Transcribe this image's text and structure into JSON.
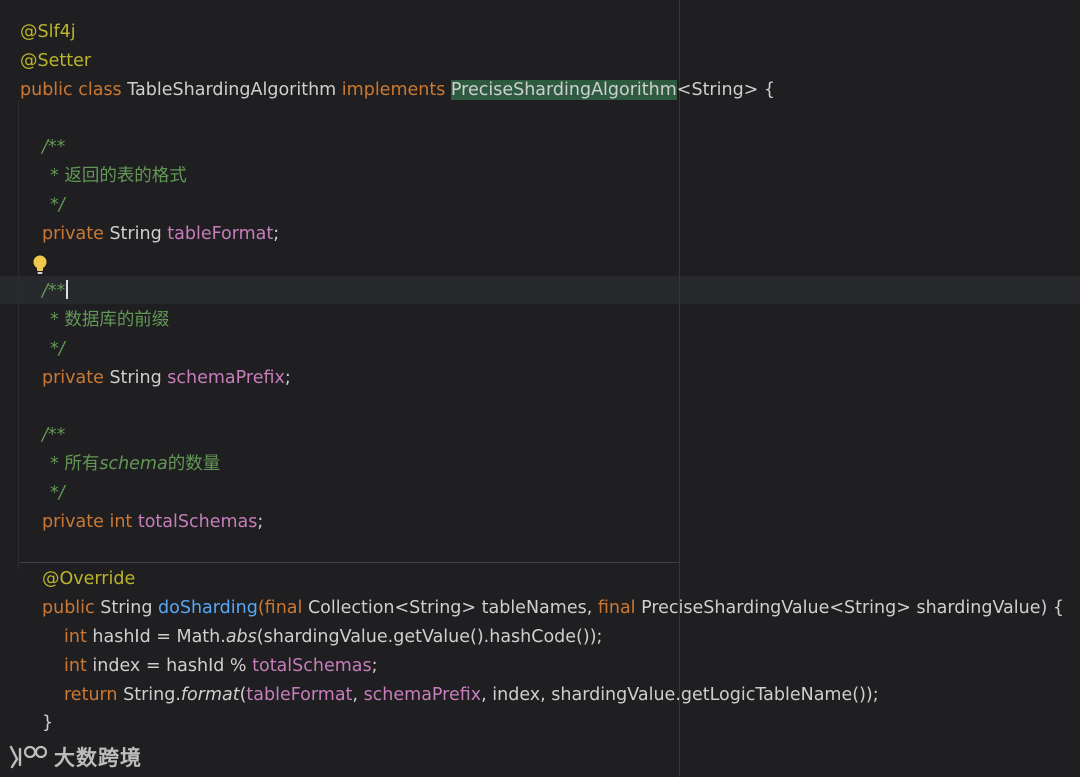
{
  "code": {
    "annotation_slf4j": "@Slf4j",
    "annotation_setter": "@Setter",
    "class_decl": {
      "public": "public",
      "class": "class",
      "name": "TableShardingAlgorithm",
      "implements": "implements",
      "interface": "PreciseShardingAlgorithm",
      "generic": "<String> {"
    },
    "comment_open": "/**",
    "comment_close": "*/",
    "doc_table_format": "* 返回的表的格式",
    "field_table_format": {
      "modifier": "private",
      "type": "String",
      "name": "tableFormat",
      "end": ";"
    },
    "doc_schema_prefix": "* 数据库的前缀",
    "field_schema_prefix": {
      "modifier": "private",
      "type": "String",
      "name": "schemaPrefix",
      "end": ";"
    },
    "doc_total_schemas": {
      "pre": "* 所有",
      "italic": "schema",
      "post": "的数量"
    },
    "field_total_schemas": {
      "modifier": "private",
      "type": "int",
      "name": "totalSchemas",
      "end": ";"
    },
    "override": "@Override",
    "method_decl": {
      "public": "public",
      "ret": "String",
      "name": "doSharding",
      "p_open": "(",
      "final1": "final",
      "param1": "Collection<String> tableNames, ",
      "final2": "final",
      "param2": "PreciseShardingValue<String> shardingValue) {"
    },
    "body1": {
      "type": "int",
      "a": "hashId = Math.",
      "b": "abs",
      "c": "(shardingValue.getValue().hashCode());"
    },
    "body2": {
      "type": "int",
      "a": "index = hashId % ",
      "field": "totalSchemas",
      "end": ";"
    },
    "body3": {
      "ret": "return",
      "a": "String.",
      "b": "format",
      "c": "(",
      "f1": "tableFormat",
      "comma": ", ",
      "f2": "schemaPrefix",
      "d": ", index, shardingValue.getLogicTableName());"
    },
    "close_brace": "}"
  },
  "watermark": {
    "text": "大数跨境"
  },
  "colors": {
    "background": "#1f1f21",
    "keyword": "#cc7832",
    "annotation": "#bbb529",
    "field": "#c77dbb",
    "comment": "#629755",
    "method": "#56a8f5",
    "highlight": "#2e5a3f"
  }
}
